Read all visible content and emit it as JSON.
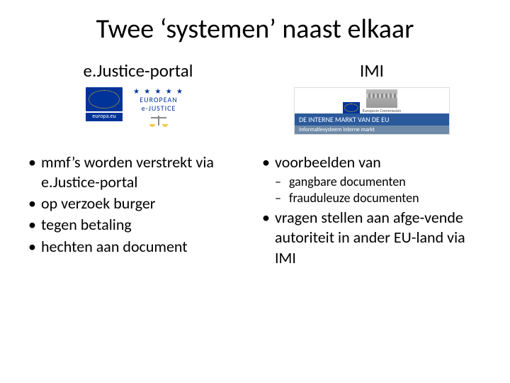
{
  "title": "Twee ‘systemen’ naast elkaar",
  "left": {
    "heading": "e.Justice-portal",
    "logos": {
      "europa_label": "europa.eu",
      "ejustice_line1": "EUROPEAN",
      "ejustice_line2": "e-JUSTICE"
    },
    "bullets": [
      "mmf’s worden verstrekt via e.Justice-portal",
      "op verzoek burger",
      "tegen betaling",
      "hechten aan document"
    ]
  },
  "right": {
    "heading": "IMI",
    "logos": {
      "bar_text": "DE INTERNE MARKT VAN DE EU",
      "sub_text": "Informatiesysteem interne markt",
      "commission_label": "European Commission"
    },
    "bullet0": "voorbeelden van",
    "sub_bullets": [
      "gangbare documenten",
      "frauduleuze documenten"
    ],
    "bullet1": "vragen stellen aan afge-vende autoriteit in ander EU-land via IMI"
  }
}
